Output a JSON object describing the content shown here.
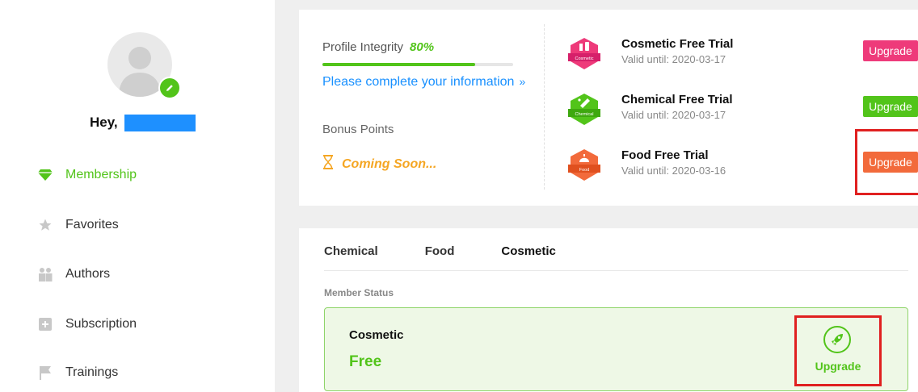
{
  "sidebar": {
    "greeting": "Hey,",
    "items": [
      {
        "label": "Membership",
        "icon": "diamond-icon",
        "active": true
      },
      {
        "label": "Favorites",
        "icon": "star-icon"
      },
      {
        "label": "Authors",
        "icon": "people-icon"
      },
      {
        "label": "Subscription",
        "icon": "subscription-icon"
      },
      {
        "label": "Trainings",
        "icon": "flag-icon"
      }
    ]
  },
  "profile": {
    "integrity_label": "Profile Integrity",
    "integrity_value": "80%",
    "integrity_progress": 0.8,
    "complete_link": "Please complete your information",
    "complete_chevron": "»",
    "bonus_label": "Bonus Points",
    "bonus_status": "Coming Soon..."
  },
  "trials": [
    {
      "title": "Cosmetic Free Trial",
      "valid": "Valid until: 2020-03-17",
      "badge_text": "Cosmetic",
      "color": "#ee3a7a",
      "button": "Upgrade"
    },
    {
      "title": "Chemical Free Trial",
      "valid": "Valid until: 2020-03-17",
      "badge_text": "Chemical",
      "color": "#52c41a",
      "button": "Upgrade"
    },
    {
      "title": "Food Free Trial",
      "valid": "Valid until: 2020-03-16",
      "badge_text": "Food",
      "color": "#f26a3b",
      "button": "Upgrade"
    }
  ],
  "tabs": [
    "Chemical",
    "Food",
    "Cosmetic"
  ],
  "member_status": {
    "label": "Member Status",
    "category": "Cosmetic",
    "value": "Free",
    "upgrade": "Upgrade"
  },
  "colors": {
    "accent": "#52c41a",
    "link": "#1890ff",
    "warning": "#f5a623",
    "highlight": "#e02020"
  }
}
